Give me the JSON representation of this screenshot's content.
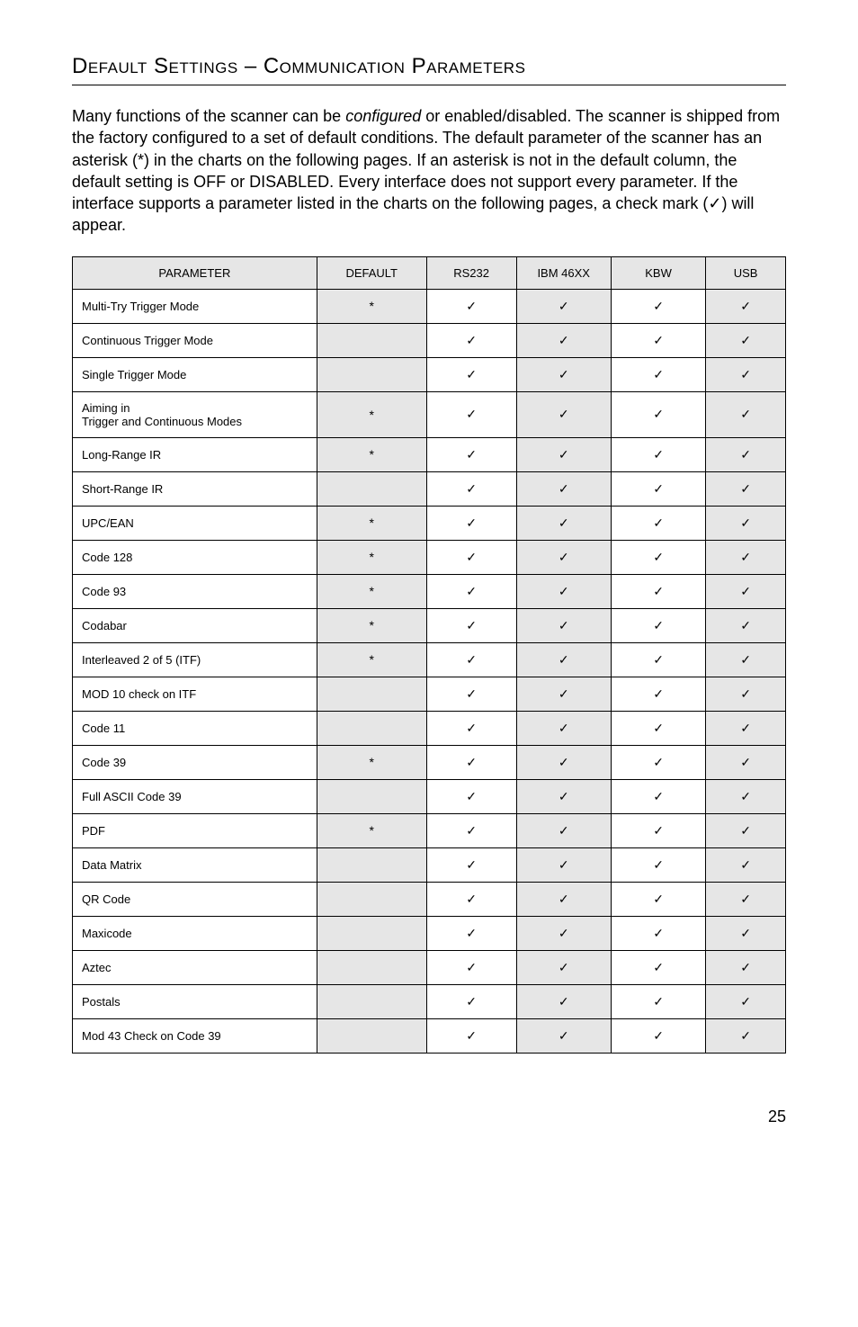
{
  "title": "Default Settings – Communication Parameters",
  "intro_html": "Many functions of the scanner can be <em>configured</em> or enabled/disabled. The scanner is shipped from the factory configured to a set of default conditions. The default parameter of the scanner has an asterisk (*) in the charts on the following pages.  If an asterisk is not in the default column, the default setting is OFF or DISABLED.  Every interface does not support every parameter.  If the interface supports a parameter listed in the charts on the following pages, a check mark (✓) will appear.",
  "headers": {
    "parameter": "PARAMETER",
    "default": "DEFAULT",
    "rs232": "RS232",
    "ibm46xx": "IBM 46XX",
    "kbw": "KBW",
    "usb": "USB"
  },
  "check": "✓",
  "star": "*",
  "page_number": "25",
  "chart_data": {
    "type": "table",
    "title": "Default Settings – Communication Parameters",
    "columns": [
      "PARAMETER",
      "DEFAULT",
      "RS232",
      "IBM 46XX",
      "KBW",
      "USB"
    ],
    "rows": [
      {
        "parameter": "Multi-Try Trigger Mode",
        "default": "*",
        "rs232": "✓",
        "ibm46xx": "✓",
        "kbw": "✓",
        "usb": "✓"
      },
      {
        "parameter": "Continuous Trigger Mode",
        "default": "",
        "rs232": "✓",
        "ibm46xx": "✓",
        "kbw": "✓",
        "usb": "✓"
      },
      {
        "parameter": "Single Trigger Mode",
        "default": "",
        "rs232": "✓",
        "ibm46xx": "✓",
        "kbw": "✓",
        "usb": "✓"
      },
      {
        "parameter": "Aiming in\nTrigger and Continuous Modes",
        "default": "*",
        "rs232": "✓",
        "ibm46xx": "✓",
        "kbw": "✓",
        "usb": "✓"
      },
      {
        "parameter": "Long-Range IR",
        "default": "*",
        "rs232": "✓",
        "ibm46xx": "✓",
        "kbw": "✓",
        "usb": "✓"
      },
      {
        "parameter": "Short-Range IR",
        "default": "",
        "rs232": "✓",
        "ibm46xx": "✓",
        "kbw": "✓",
        "usb": "✓"
      },
      {
        "parameter": "UPC/EAN",
        "default": "*",
        "rs232": "✓",
        "ibm46xx": "✓",
        "kbw": "✓",
        "usb": "✓"
      },
      {
        "parameter": "Code 128",
        "default": "*",
        "rs232": "✓",
        "ibm46xx": "✓",
        "kbw": "✓",
        "usb": "✓"
      },
      {
        "parameter": "Code 93",
        "default": "*",
        "rs232": "✓",
        "ibm46xx": "✓",
        "kbw": "✓",
        "usb": "✓"
      },
      {
        "parameter": "Codabar",
        "default": "*",
        "rs232": "✓",
        "ibm46xx": "✓",
        "kbw": "✓",
        "usb": "✓"
      },
      {
        "parameter": "Interleaved 2 of 5 (ITF)",
        "default": "*",
        "rs232": "✓",
        "ibm46xx": "✓",
        "kbw": "✓",
        "usb": "✓"
      },
      {
        "parameter": "MOD 10 check on ITF",
        "default": "",
        "rs232": "✓",
        "ibm46xx": "✓",
        "kbw": "✓",
        "usb": "✓"
      },
      {
        "parameter": "Code 11",
        "default": "",
        "rs232": "✓",
        "ibm46xx": "✓",
        "kbw": "✓",
        "usb": "✓"
      },
      {
        "parameter": "Code 39",
        "default": "*",
        "rs232": "✓",
        "ibm46xx": "✓",
        "kbw": "✓",
        "usb": "✓"
      },
      {
        "parameter": "Full ASCII Code 39",
        "default": "",
        "rs232": "✓",
        "ibm46xx": "✓",
        "kbw": "✓",
        "usb": "✓"
      },
      {
        "parameter": "PDF",
        "default": "*",
        "rs232": "✓",
        "ibm46xx": "✓",
        "kbw": "✓",
        "usb": "✓"
      },
      {
        "parameter": "Data Matrix",
        "default": "",
        "rs232": "✓",
        "ibm46xx": "✓",
        "kbw": "✓",
        "usb": "✓"
      },
      {
        "parameter": "QR Code",
        "default": "",
        "rs232": "✓",
        "ibm46xx": "✓",
        "kbw": "✓",
        "usb": "✓"
      },
      {
        "parameter": "Maxicode",
        "default": "",
        "rs232": "✓",
        "ibm46xx": "✓",
        "kbw": "✓",
        "usb": "✓"
      },
      {
        "parameter": "Aztec",
        "default": "",
        "rs232": "✓",
        "ibm46xx": "✓",
        "kbw": "✓",
        "usb": "✓"
      },
      {
        "parameter": "Postals",
        "default": "",
        "rs232": "✓",
        "ibm46xx": "✓",
        "kbw": "✓",
        "usb": "✓"
      },
      {
        "parameter": "Mod 43 Check on Code 39",
        "default": "",
        "rs232": "✓",
        "ibm46xx": "✓",
        "kbw": "✓",
        "usb": "✓"
      }
    ]
  }
}
